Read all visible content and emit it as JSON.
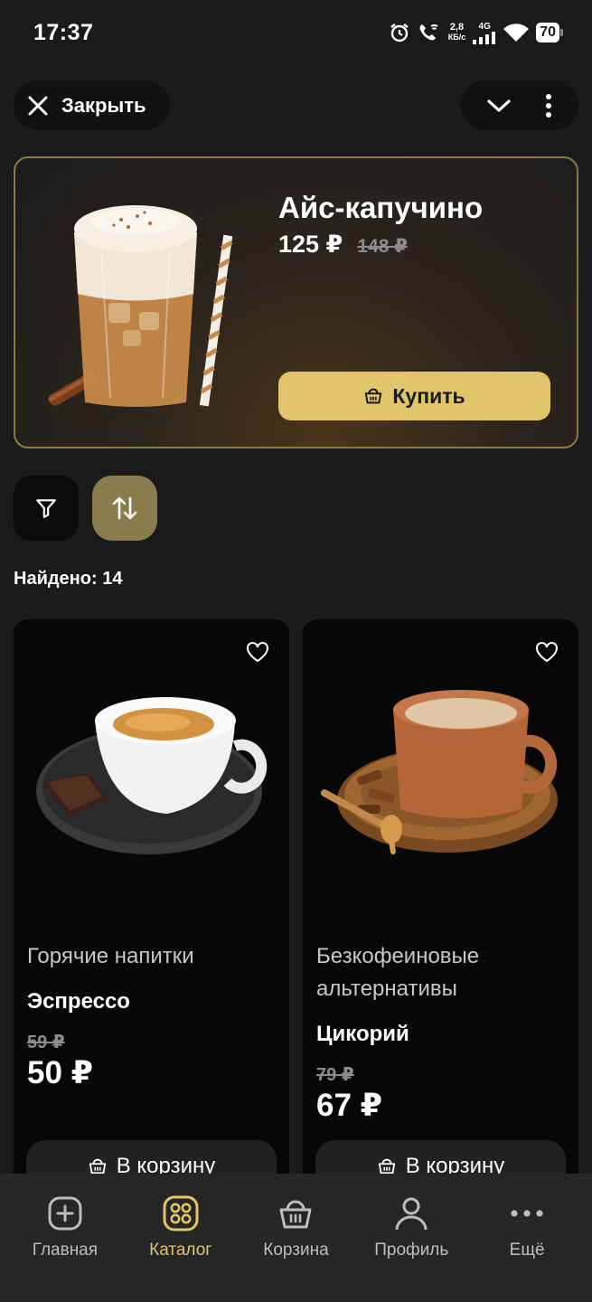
{
  "status_bar": {
    "time": "17:37",
    "net_speed_top": "2,8",
    "net_speed_bottom": "КБ/с",
    "network": "4G",
    "battery": "70"
  },
  "top": {
    "close_label": "Закрыть"
  },
  "hero": {
    "title": "Айс-капучино",
    "price": "125 ₽",
    "old_price": "148 ₽",
    "buy_label": "Купить"
  },
  "filters": {
    "found": "Найдено: 14"
  },
  "products": [
    {
      "category": "Горячие напитки",
      "name": "Эспрессо",
      "old_price": "59 ₽",
      "price": "50 ₽",
      "cart_label": "В корзину"
    },
    {
      "category": "Безкофеиновые альтернативы",
      "name": "Цикорий",
      "old_price": "79 ₽",
      "price": "67 ₽",
      "cart_label": "В корзину"
    }
  ],
  "nav": {
    "items": [
      {
        "label": "Главная",
        "icon": "plus-square-icon"
      },
      {
        "label": "Каталог",
        "icon": "grid-icon"
      },
      {
        "label": "Корзина",
        "icon": "basket-icon"
      },
      {
        "label": "Профиль",
        "icon": "person-icon"
      },
      {
        "label": "Ещё",
        "icon": "more-dots-icon"
      }
    ],
    "active": "Каталог"
  },
  "colors": {
    "accent": "#e1c46c",
    "background": "#1a1a1a",
    "card": "#070707"
  }
}
